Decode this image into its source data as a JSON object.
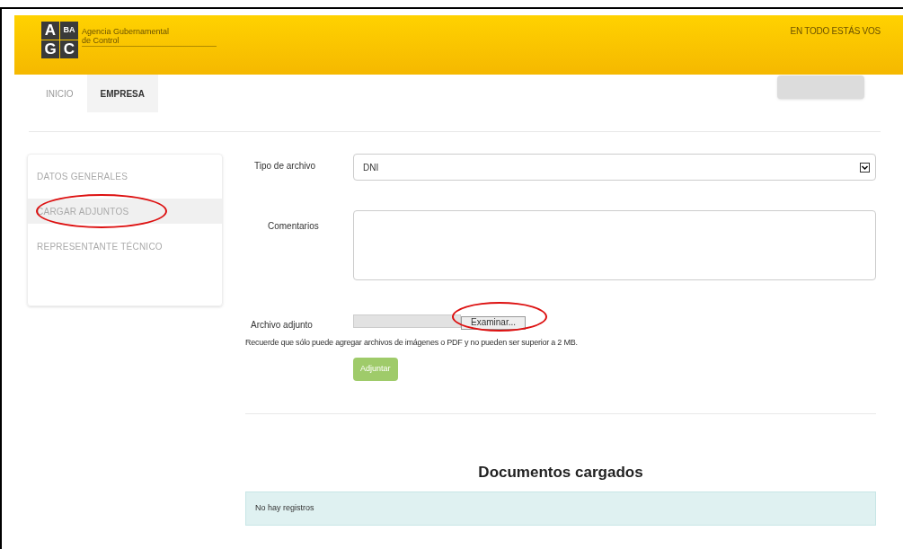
{
  "header": {
    "logo": [
      "A",
      "BA",
      "G",
      "C"
    ],
    "agency": [
      "Agencia Gubernamental",
      "de Control"
    ],
    "slogan": "EN TODO ESTÁS VOS"
  },
  "nav": [
    {
      "label": "INICIO",
      "selected": false
    },
    {
      "label": "EMPRESA",
      "selected": true
    }
  ],
  "sidebar": {
    "items": [
      {
        "label": "DATOS GENERALES",
        "selected": false,
        "annotated": false
      },
      {
        "label": "CARGAR ADJUNTOS",
        "selected": true,
        "annotated": true
      },
      {
        "label": "REPRESENTANTE TÉCNICO",
        "selected": false,
        "annotated": false
      }
    ]
  },
  "form": {
    "file_type": {
      "label": "Tipo de archivo",
      "value": "DNI"
    },
    "comments": {
      "label": "Comentarios"
    },
    "attachment": {
      "label": "Archivo adjunto",
      "browse": "Examinar...",
      "annotated": true
    },
    "note": "Recuerde que sólo puede agregar archivos de imágenes o PDF y no pueden ser superior a 2 MB.",
    "submit": "Adjuntar"
  },
  "documents": {
    "title": "Documentos cargados",
    "empty": "No hay registros"
  }
}
